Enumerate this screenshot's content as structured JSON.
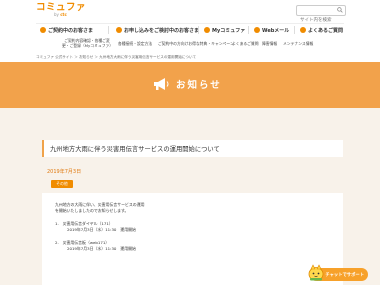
{
  "header": {
    "logo_main": "コミュファ",
    "logo_sub_prefix": "by ",
    "logo_sub_brand": "ctc",
    "search": {
      "placeholder": "サイト内を検索",
      "icon": "search-icon"
    }
  },
  "main_nav": [
    {
      "label": "ご契約中のお客さま",
      "icon": "person-icon",
      "color": "#f08c00"
    },
    {
      "label": "お申し込みをご検討中のお客さま",
      "icon": "cart-icon",
      "color": "#f08c00"
    },
    {
      "label": "Myコミュファ",
      "icon": "my-icon",
      "color": "#f08c00"
    },
    {
      "label": "Webメール",
      "icon": "mail-icon",
      "color": "#f08c00"
    },
    {
      "label": "よくあるご質問",
      "icon": "question-icon",
      "color": "#f08c00"
    }
  ],
  "sub_nav": [
    "ご契約内容確認・各種ご変更・ご登録（Myコミュファ）",
    "各種接続・設定方法",
    "ご契約中の方向けお得な特典・キャンペーン",
    "よくあるご質問",
    "障害情報",
    "メンテナンス情報"
  ],
  "breadcrumb": "コミュファ 公式サイト ＞ お知らせ ＞ 九州地方大雨に伴う災害用伝言サービスの運用開始について",
  "banner": {
    "title": "お知らせ",
    "icon": "megaphone-icon"
  },
  "article": {
    "title": "九州地方大雨に伴う災害用伝言サービスの運用開始について",
    "date": "2019年7月3日",
    "tag": "その他",
    "intro": [
      "九州地方の大雨に伴い、災害用伝言サービスの運用",
      "を開始いたしましたのでお知らせします。"
    ],
    "items": [
      {
        "heading": "1.　災害用伝言ダイヤル（171）",
        "detail": "2019年7月3日（水）11:30　運用開始"
      },
      {
        "heading": "2.　災害用伝言板（web171）",
        "detail": "2019年7月3日（水）11:30　運用開始"
      }
    ]
  },
  "chat": {
    "label": "チャットでサポート",
    "icon": "mascot-icon"
  },
  "colors": {
    "accent": "#f08c00",
    "banner": "#f2a24b",
    "content_bg": "#f8f2ea"
  }
}
